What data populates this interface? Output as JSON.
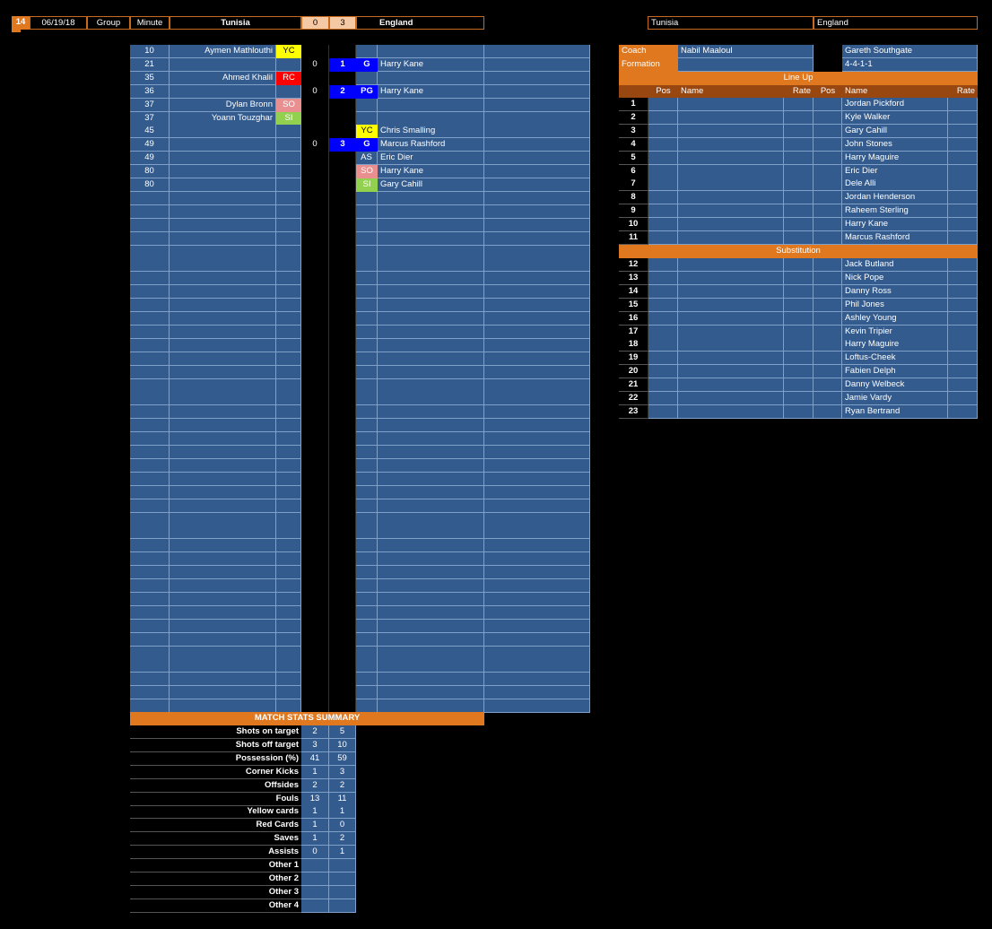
{
  "header": {
    "match_no": "14",
    "date": "06/19/18",
    "stage": "Group",
    "minute_label": "Minute",
    "home_team": "Tunisia",
    "home_score": "0",
    "away_score": "3",
    "away_team": "England"
  },
  "events": [
    {
      "minute": "10",
      "home_player": "Aymen Mathlouthi",
      "home_code": "YC",
      "home_score": "",
      "away_score": "",
      "away_code": "",
      "away_player": ""
    },
    {
      "minute": "21",
      "home_player": "",
      "home_code": "",
      "home_score": "0",
      "away_score": "1",
      "away_code": "G",
      "away_player": "Harry Kane"
    },
    {
      "minute": "35",
      "home_player": "Ahmed Khalil",
      "home_code": "RC",
      "home_score": "",
      "away_score": "",
      "away_code": "",
      "away_player": ""
    },
    {
      "minute": "36",
      "home_player": "",
      "home_code": "",
      "home_score": "0",
      "away_score": "2",
      "away_code": "PG",
      "away_player": "Harry Kane"
    },
    {
      "minute": "37",
      "home_player": "Dylan Bronn",
      "home_code": "SO",
      "home_score": "",
      "away_score": "",
      "away_code": "",
      "away_player": ""
    },
    {
      "minute": "37",
      "home_player": "Yoann Touzghar",
      "home_code": "SI",
      "home_score": "",
      "away_score": "",
      "away_code": "",
      "away_player": ""
    },
    {
      "minute": "45",
      "home_player": "",
      "home_code": "",
      "home_score": "",
      "away_score": "",
      "away_code": "YC",
      "away_player": "Chris Smalling"
    },
    {
      "minute": "49",
      "home_player": "",
      "home_code": "",
      "home_score": "0",
      "away_score": "3",
      "away_code": "G",
      "away_player": "Marcus Rashford"
    },
    {
      "minute": "49",
      "home_player": "",
      "home_code": "",
      "home_score": "",
      "away_score": "",
      "away_code": "AS",
      "away_player": "Eric Dier"
    },
    {
      "minute": "80",
      "home_player": "",
      "home_code": "",
      "home_score": "",
      "away_score": "",
      "away_code": "SO",
      "away_player": "Harry Kane"
    },
    {
      "minute": "80",
      "home_player": "",
      "home_code": "",
      "home_score": "",
      "away_score": "",
      "away_code": "SI",
      "away_player": "Gary Cahill"
    }
  ],
  "colors": {
    "cell_blue": "#335b8d",
    "orange": "#e0781f",
    "brown": "#97470f",
    "yellow_card": "#ffff00",
    "red_card": "#ff0000",
    "sub_out": "#ea8f8f",
    "sub_in": "#92d050",
    "goal": "#0000ff"
  },
  "stats": {
    "title": "MATCH STATS SUMMARY",
    "rows": [
      {
        "label": "Shots on target",
        "home": "2",
        "away": "5"
      },
      {
        "label": "Shots off target",
        "home": "3",
        "away": "10"
      },
      {
        "label": "Possession (%)",
        "home": "41",
        "away": "59"
      },
      {
        "label": "Corner Kicks",
        "home": "1",
        "away": "3"
      },
      {
        "label": "Offsides",
        "home": "2",
        "away": "2"
      },
      {
        "label": "Fouls",
        "home": "13",
        "away": "11"
      },
      {
        "label": "Yellow cards",
        "home": "1",
        "away": "1"
      },
      {
        "label": "Red Cards",
        "home": "1",
        "away": "0"
      },
      {
        "label": "Saves",
        "home": "1",
        "away": "2"
      },
      {
        "label": "Assists",
        "home": "0",
        "away": "1"
      },
      {
        "label": "Other 1",
        "home": "",
        "away": ""
      },
      {
        "label": "Other 2",
        "home": "",
        "away": ""
      },
      {
        "label": "Other 3",
        "home": "",
        "away": ""
      },
      {
        "label": "Other 4",
        "home": "",
        "away": ""
      }
    ]
  },
  "teams": {
    "home_name": "Tunisia",
    "away_name": "England",
    "coach_label": "Coach",
    "formation_label": "Formation",
    "home_coach": "Nabil Maaloul",
    "away_coach": "Gareth Southgate",
    "home_formation": "",
    "away_formation": "4-4-1-1",
    "lineup_title": "Line Up",
    "sub_title": "Substitution",
    "col_pos": "Pos",
    "col_name": "Name",
    "col_rate": "Rate",
    "lineup": [
      {
        "no": "1",
        "away": "Jordan Pickford"
      },
      {
        "no": "2",
        "away": "Kyle Walker"
      },
      {
        "no": "3",
        "away": "Gary Cahill"
      },
      {
        "no": "4",
        "away": "John Stones"
      },
      {
        "no": "5",
        "away": "Harry Maguire"
      },
      {
        "no": "6",
        "away": "Eric Dier"
      },
      {
        "no": "7",
        "away": "Dele Alli"
      },
      {
        "no": "8",
        "away": "Jordan Henderson"
      },
      {
        "no": "9",
        "away": "Raheem Sterling"
      },
      {
        "no": "10",
        "away": "Harry Kane"
      },
      {
        "no": "11",
        "away": "Marcus Rashford"
      }
    ],
    "subs": [
      {
        "no": "12",
        "away": "Jack Butland"
      },
      {
        "no": "13",
        "away": "Nick Pope"
      },
      {
        "no": "14",
        "away": "Danny Ross"
      },
      {
        "no": "15",
        "away": "Phil Jones"
      },
      {
        "no": "16",
        "away": "Ashley Young"
      },
      {
        "no": "17",
        "away": "Kevin Tripier"
      },
      {
        "no": "18",
        "away": "Harry Maguire"
      },
      {
        "no": "19",
        "away": "Loftus-Cheek"
      },
      {
        "no": "20",
        "away": "Fabien Delph"
      },
      {
        "no": "21",
        "away": "Danny Welbeck"
      },
      {
        "no": "22",
        "away": "Jamie Vardy"
      },
      {
        "no": "23",
        "away": "Ryan Bertrand"
      }
    ]
  }
}
